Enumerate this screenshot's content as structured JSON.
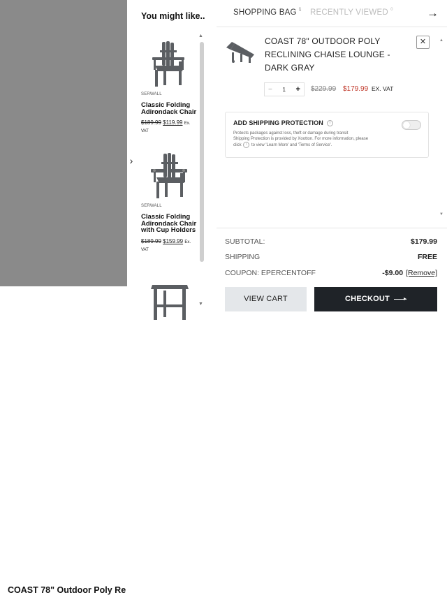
{
  "background": {
    "product_title": "COAST 78\" Outdoor Poly Re"
  },
  "suggestions": {
    "title": "You might like..",
    "nav_icon": "chevron-right-icon",
    "items": [
      {
        "brand": "SERWALL",
        "name": "Classic Folding Adirondack Chair",
        "old_price": "$189.99",
        "new_price": "$119.99",
        "vat": "Ex. VAT",
        "image": "adirondack-chair"
      },
      {
        "brand": "SERWALL",
        "name": "Classic Folding Adirondack Chair with Cup Holders",
        "old_price": "$189.99",
        "new_price": "$159.99",
        "vat": "Ex. VAT",
        "image": "adirondack-chair-cupholders"
      },
      {
        "image": "side-table"
      }
    ]
  },
  "panel": {
    "tabs": [
      {
        "label": "SHOPPING BAG",
        "count": "1"
      },
      {
        "label": "RECENTLY VIEWED",
        "count": "0"
      }
    ],
    "close_icon": "arrow-right-icon",
    "cart_item": {
      "name": "COAST 78\" OUTDOOR POLY RECLINING CHAISE LOUNGE - DARK GRAY",
      "quantity": "1",
      "old_price": "$229.99",
      "new_price": "$179.99",
      "vat": "EX. VAT",
      "image": "chaise-lounge"
    },
    "shipping_protection": {
      "title": "ADD SHIPPING PROTECTION",
      "description_1": "Protects packages against loss, theft or damage during transit",
      "description_2": "Shipping Protection is provided by Xootton. For more information, please",
      "description_3_a": "click",
      "description_3_b": "to view 'Learn More' and 'Terms of Service'.",
      "enabled": false
    },
    "summary": {
      "subtotal_label": "SUBTOTAL:",
      "subtotal_value": "$179.99",
      "shipping_label": "SHIPPING",
      "shipping_value": "FREE",
      "coupon_label": "COUPON: EPERCENTOFF",
      "coupon_value": "-$9.00",
      "coupon_remove": "[Remove]"
    },
    "buttons": {
      "view_cart": "VIEW CART",
      "checkout": "CHECKOUT"
    }
  },
  "colors": {
    "overlay": "#8a8a8a",
    "sale_price": "#c0392b",
    "checkout_bg": "#1f2328",
    "view_cart_bg": "#e4e7ea"
  }
}
